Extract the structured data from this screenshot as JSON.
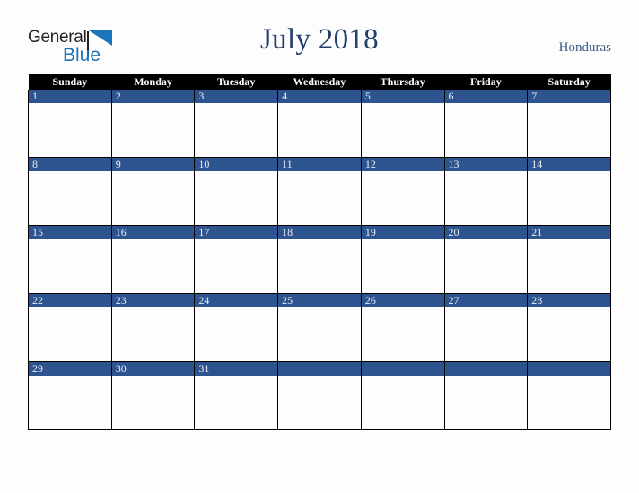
{
  "brand": {
    "name_part1": "General",
    "name_part2": "Blue",
    "triangle_color": "#1b75bb",
    "text_color": "#231f20"
  },
  "header": {
    "title": "July 2018",
    "country": "Honduras",
    "title_color": "#27406b",
    "country_color": "#3c5a8a"
  },
  "calendar": {
    "weekday_headers": [
      "Sunday",
      "Monday",
      "Tuesday",
      "Wednesday",
      "Thursday",
      "Friday",
      "Saturday"
    ],
    "accent_color": "#2e5490",
    "header_bg": "#000000",
    "header_fg": "#ffffff",
    "daynum_fg": "#e9eef6",
    "weeks": [
      [
        "1",
        "2",
        "3",
        "4",
        "5",
        "6",
        "7"
      ],
      [
        "8",
        "9",
        "10",
        "11",
        "12",
        "13",
        "14"
      ],
      [
        "15",
        "16",
        "17",
        "18",
        "19",
        "20",
        "21"
      ],
      [
        "22",
        "23",
        "24",
        "25",
        "26",
        "27",
        "28"
      ],
      [
        "29",
        "30",
        "31",
        "",
        "",
        "",
        ""
      ]
    ]
  }
}
